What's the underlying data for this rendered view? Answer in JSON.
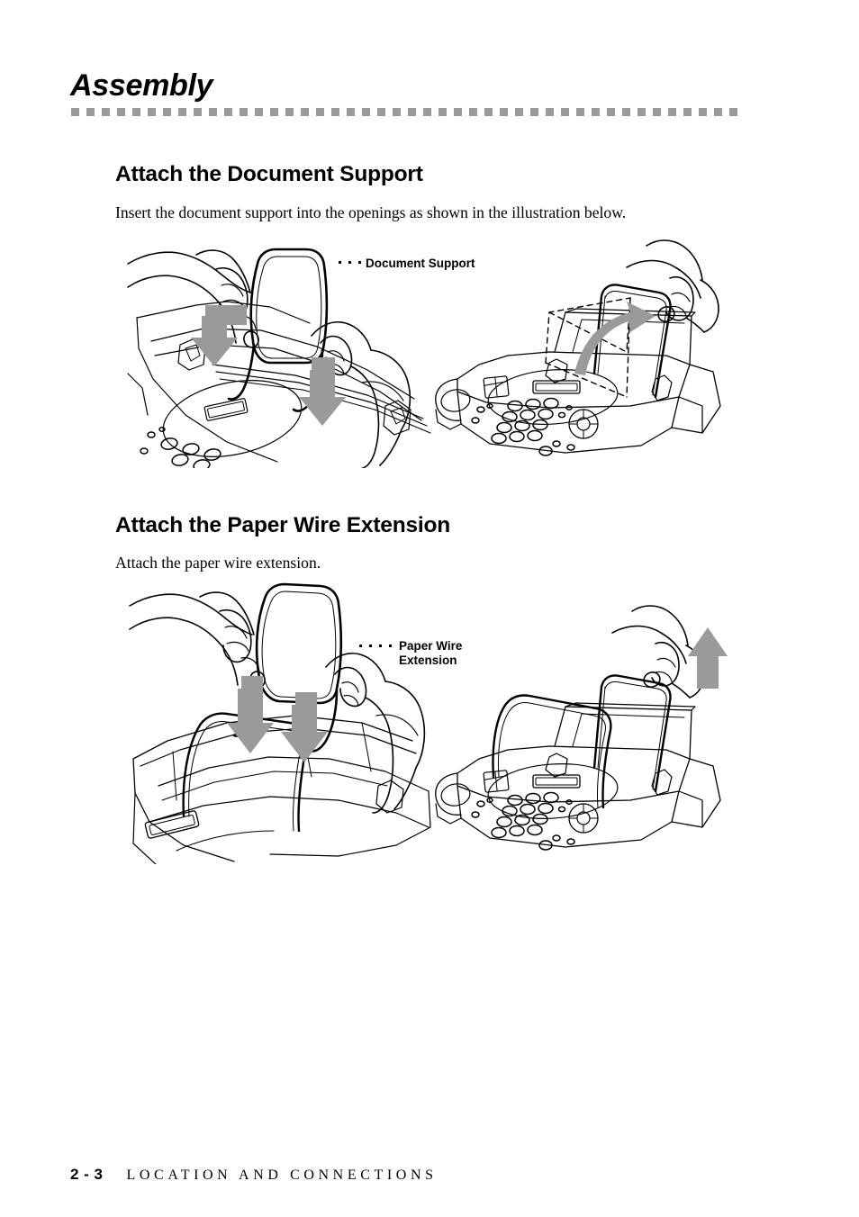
{
  "document": {
    "chapter_title": "Assembly",
    "rule_color": "#9a9a9a"
  },
  "sections": [
    {
      "heading": "Attach the Document Support",
      "body": "Insert the document support into the openings as shown in the illustration below.",
      "figure": {
        "name": "document-support-illustration",
        "callout": "Document Support",
        "panels": [
          {
            "name": "close-up-inserting-document-support",
            "description": "Two hands inserting the wire document support legs into the openings on top of the fax machine",
            "arrows": 2,
            "arrow_color": "#9a9a9a"
          },
          {
            "name": "fax-machine-with-document-support",
            "description": "Hand rotating the attached document support upright on the fax machine",
            "arrows": 1,
            "arrow_color": "#9a9a9a"
          }
        ]
      }
    },
    {
      "heading": "Attach the Paper Wire Extension",
      "body": "Attach the paper wire extension.",
      "figure": {
        "name": "paper-wire-extension-illustration",
        "callout_line1": "Paper Wire",
        "callout_line2": "Extension",
        "panels": [
          {
            "name": "close-up-inserting-paper-wire-extension",
            "description": "Two hands inserting the paper wire extension into the paper tray of the fax machine",
            "arrows": 2,
            "arrow_color": "#9a9a9a"
          },
          {
            "name": "fax-machine-with-paper-wire-extension",
            "description": "Hand pulling the paper wire extension upward on the assembled fax machine",
            "arrows": 1,
            "arrow_color": "#9a9a9a"
          }
        ]
      }
    }
  ],
  "footer": {
    "page_number": "2 - 3",
    "chapter_name": "LOCATION AND CONNECTIONS"
  }
}
